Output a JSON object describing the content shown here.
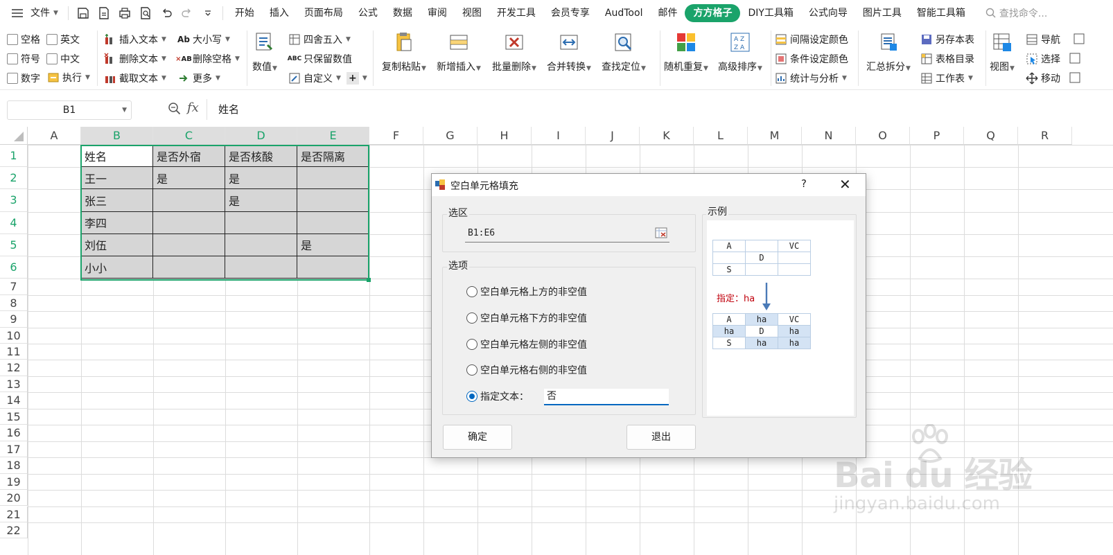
{
  "menubar": {
    "file_label": "文件",
    "tabs": [
      "开始",
      "插入",
      "页面布局",
      "公式",
      "数据",
      "审阅",
      "视图",
      "开发工具",
      "会员专享",
      "AudTool",
      "邮件",
      "方方格子",
      "DIY工具箱",
      "公式向导",
      "图片工具",
      "智能工具箱"
    ],
    "active_tab": "方方格子",
    "search_placeholder": "查找命令..."
  },
  "ribbon": {
    "checkboxes": [
      "空格",
      "英文",
      "符号",
      "中文",
      "数字"
    ],
    "exec_label": "执行",
    "text_tools": [
      "插入文本",
      "删除文本",
      "截取文本"
    ],
    "case_tools": [
      "大小写",
      "删除空格",
      "更多"
    ],
    "value_label": "数值",
    "round_tools": [
      "四舍五入",
      "只保留数值",
      "自定义"
    ],
    "big_buttons": [
      "复制粘贴",
      "新增插入",
      "批量删除",
      "合并转换",
      "查找定位",
      "随机重复",
      "高级排序"
    ],
    "color_tools": [
      "间隔设定颜色",
      "条件设定颜色",
      "统计与分析"
    ],
    "split_label": "汇总拆分",
    "sheet_tools": [
      "另存本表",
      "表格目录",
      "工作表"
    ],
    "view_label": "视图",
    "nav_tools": [
      "导航",
      "选择",
      "移动"
    ]
  },
  "formula_bar": {
    "cell_ref": "B1",
    "fx": "fx",
    "content": "姓名"
  },
  "grid": {
    "columns": [
      "A",
      "B",
      "C",
      "D",
      "E",
      "F",
      "G",
      "H",
      "I",
      "J",
      "K",
      "L",
      "M",
      "N",
      "O",
      "P",
      "Q",
      "R"
    ],
    "rows": [
      "1",
      "2",
      "3",
      "4",
      "5",
      "6",
      "7",
      "8",
      "9",
      "10",
      "11",
      "12",
      "13",
      "14",
      "15",
      "16",
      "17",
      "18",
      "19",
      "20",
      "21",
      "22"
    ],
    "table": [
      [
        "姓名",
        "是否外宿",
        "是否核酸",
        "是否隔离"
      ],
      [
        "王一",
        "是",
        "是",
        ""
      ],
      [
        "张三",
        "",
        "是",
        ""
      ],
      [
        "李四",
        "",
        "",
        ""
      ],
      [
        "刘伍",
        "",
        "",
        "是"
      ],
      [
        "小小",
        "",
        "",
        ""
      ]
    ]
  },
  "dialog": {
    "title": "空白单元格填充",
    "help": "?",
    "close": "✕",
    "range_group": "选区",
    "range_value": "B1:E6",
    "options_group": "选项",
    "options": [
      "空白单元格上方的非空值",
      "空白单元格下方的非空值",
      "空白单元格左侧的非空值",
      "空白单元格右侧的非空值",
      "指定文本："
    ],
    "selected_option": 4,
    "specified_text": "否",
    "example_group": "示例",
    "example_before": [
      [
        "A",
        "",
        "VC"
      ],
      [
        "",
        "D",
        ""
      ],
      [
        "S",
        "",
        ""
      ]
    ],
    "example_label": "指定：ha",
    "example_after": [
      [
        "A",
        "ha",
        "VC"
      ],
      [
        "ha",
        "D",
        "ha"
      ],
      [
        "S",
        "ha",
        "ha"
      ]
    ],
    "ok_label": "确定",
    "exit_label": "退出"
  },
  "watermark": {
    "brand": "Bai du 经验",
    "url": "jingyan.baidu.com"
  },
  "colors": {
    "accent": "#1aa36a",
    "selection_fill": "#d6d6d6",
    "radio_blue": "#0067c0",
    "example_highlight": "#d4e3f4"
  }
}
